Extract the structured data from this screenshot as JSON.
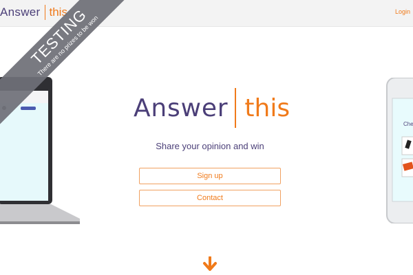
{
  "header": {
    "logo_word1": "Answer",
    "logo_word2": "this",
    "login_label": "Login"
  },
  "hero": {
    "logo_word1": "Answer",
    "logo_word2": "this",
    "tagline": "Share your opinion and win",
    "signup_label": "Sign up",
    "contact_label": "Contact"
  },
  "banner": {
    "title": "TESTING",
    "subtitle": "There are no prizes to be won"
  },
  "phone_preview": {
    "partial_text": "Che"
  },
  "colors": {
    "brand_purple": "#4b3f78",
    "brand_orange": "#f07a1a",
    "banner_gray": "#6f7078"
  },
  "icons": {
    "scroll_down": "arrow-down-icon"
  }
}
